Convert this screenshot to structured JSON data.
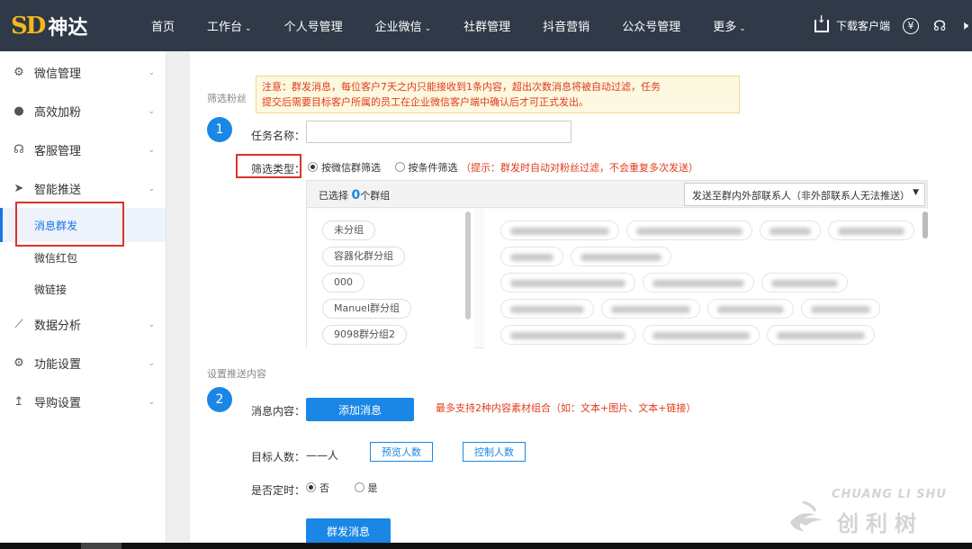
{
  "brand": {
    "mark": "SD",
    "name": "神达"
  },
  "nav": [
    {
      "label": "首页",
      "caret": false
    },
    {
      "label": "工作台",
      "caret": true
    },
    {
      "label": "个人号管理",
      "caret": false
    },
    {
      "label": "企业微信",
      "caret": true
    },
    {
      "label": "社群管理",
      "caret": false
    },
    {
      "label": "抖音营销",
      "caret": false
    },
    {
      "label": "公众号管理",
      "caret": false
    },
    {
      "label": "更多",
      "caret": true
    }
  ],
  "header_right": {
    "download_label": "下载客户端",
    "yen_icon": "yen-icon",
    "support_icon": "headset-icon",
    "sound_icon": "speaker-icon"
  },
  "sidebar": {
    "items": [
      {
        "label": "微信管理",
        "icon": "gears-icon"
      },
      {
        "label": "高效加粉",
        "icon": "user-icon"
      },
      {
        "label": "客服管理",
        "icon": "headset-icon"
      },
      {
        "label": "智能推送",
        "icon": "send-icon"
      }
    ],
    "sub_items": [
      {
        "label": "消息群发",
        "active": true
      },
      {
        "label": "微信红包",
        "active": false
      },
      {
        "label": "微链接",
        "active": false
      }
    ],
    "items_after": [
      {
        "label": "数据分析",
        "icon": "chart-icon"
      },
      {
        "label": "功能设置",
        "icon": "gears-icon"
      },
      {
        "label": "导购设置",
        "icon": "upload-icon"
      }
    ]
  },
  "form": {
    "section1_label": "筛选粉丝",
    "step1": "1",
    "notice_line1": "注意：群发消息，每位客户7天之内只能接收到1条内容，超出次数消息将被自动过滤，任务",
    "notice_line2": "提交后需要目标客户所属的员工在企业微信客户端中确认后才可正式发出。",
    "task_name_label": "任务名称：",
    "task_name_value": "",
    "filter_type_label": "筛选类型：",
    "filter_option_1": "按微信群筛选",
    "filter_option_2": "按条件筛选",
    "filter_tip": "（提示：群发时自动对粉丝过滤，不会重复多次发送）",
    "selected_prefix": "已选择",
    "selected_count": "0",
    "selected_suffix": "个群组",
    "send_target_select": "发送至群内外部联系人（非外部联系人无法推送）",
    "groups": [
      "未分组",
      "容器化群分组",
      "000",
      "Manuel群分组",
      "9098群分组2"
    ],
    "section2_label": "设置推送内容",
    "step2": "2",
    "content_label": "消息内容：",
    "add_message_button": "添加消息",
    "content_tip": "最多支持2种内容素材组合（如：文本+图片、文本+链接）",
    "target_label": "目标人数：",
    "target_value": "——人",
    "preview_button": "预览人数",
    "control_button": "控制人数",
    "schedule_label": "是否定时：",
    "schedule_no": "否",
    "schedule_yes": "是",
    "submit_button": "群发消息"
  },
  "watermark": {
    "en": "CHUANG LI SHU",
    "cn": "创利树"
  },
  "colors": {
    "topbar": "#2f3947",
    "accent": "#1a87e6",
    "highlight": "#d9342b",
    "warning_text": "#e03b1a"
  }
}
